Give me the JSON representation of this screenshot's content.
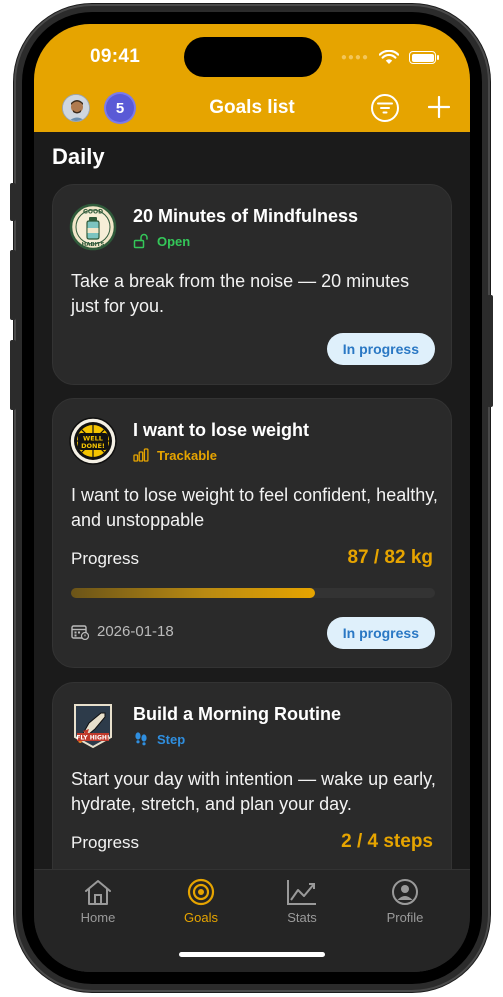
{
  "status_bar": {
    "time": "09:41"
  },
  "header": {
    "title": "Goals list",
    "notification_count": "5",
    "filter_icon": "filter-icon",
    "add_icon": "plus-icon",
    "accent_color": "#e6a400"
  },
  "section": {
    "title": "Daily"
  },
  "goals": [
    {
      "title": "20 Minutes of Mindfulness",
      "badge_text_top": "GOOD",
      "badge_text_bottom": "HABITS",
      "type_label": "Open",
      "type_icon": "unlock-icon",
      "type_color": "#34c759",
      "description": "Take a break from the noise — 20 minutes just for you.",
      "status": "In progress"
    },
    {
      "title": "I want to lose weight",
      "badge_text_top": "WELL",
      "badge_text_bottom": "DONE!",
      "type_label": "Trackable",
      "type_icon": "bars-icon",
      "type_color": "#e6a400",
      "description": "I want to lose weight to feel confident, healthy, and unstoppable",
      "progress_label": "Progress",
      "progress_value": "87 / 82 kg",
      "progress_fraction": 0.67,
      "date": "2026-01-18",
      "status": "In progress"
    },
    {
      "title": "Build a Morning Routine",
      "badge_text": "FLY HIGH!",
      "type_label": "Step",
      "type_icon": "footsteps-icon",
      "type_color": "#2f8fe0",
      "description": "Start your day with intention — wake up early, hydrate, stretch, and plan your day.",
      "progress_label": "Progress",
      "progress_value": "2 / 4 steps"
    }
  ],
  "tabbar": {
    "items": [
      {
        "label": "Home",
        "icon": "home-icon"
      },
      {
        "label": "Goals",
        "icon": "target-icon",
        "active": true
      },
      {
        "label": "Stats",
        "icon": "chart-icon"
      },
      {
        "label": "Profile",
        "icon": "person-icon"
      }
    ]
  }
}
